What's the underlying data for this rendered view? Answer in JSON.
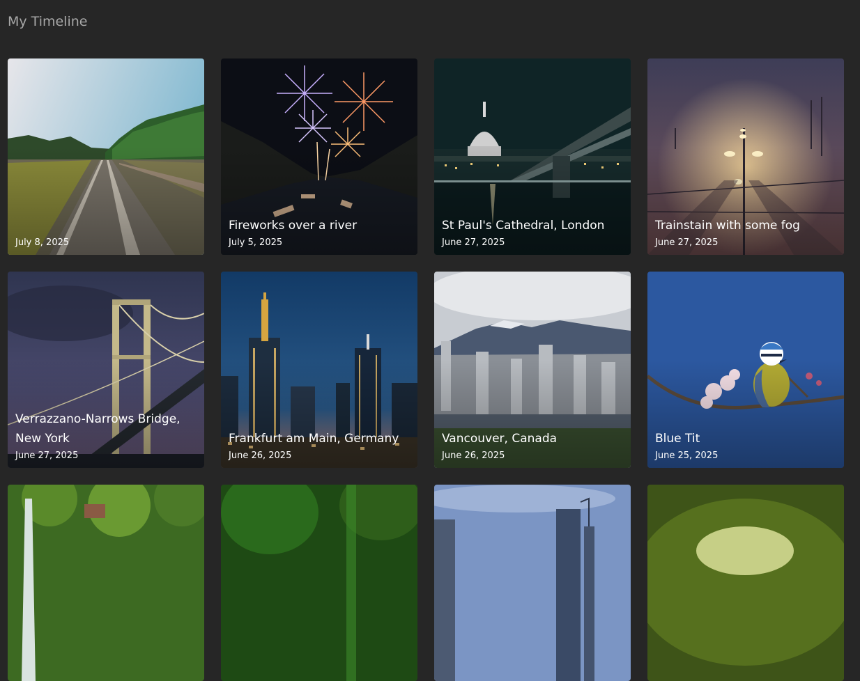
{
  "header": {
    "title": "My Timeline"
  },
  "cards": [
    {
      "title": "",
      "date": "July 8, 2025",
      "image": "railway-tracks-forest"
    },
    {
      "title": "Fireworks over a river",
      "date": "July 5, 2025",
      "image": "fireworks-river-night"
    },
    {
      "title": "St Paul's Cathedral, London",
      "date": "June 27, 2025",
      "image": "st-pauls-cathedral-bridge"
    },
    {
      "title": "Trainstain with some fog",
      "date": "June 27, 2025",
      "image": "foggy-train-station"
    },
    {
      "title": "Verrazzano-Narrows Bridge, New York",
      "date": "June 27, 2025",
      "image": "suspension-bridge-dusk"
    },
    {
      "title": "Frankfurt am Main, Germany",
      "date": "June 26, 2025",
      "image": "frankfurt-skyline-night"
    },
    {
      "title": "Vancouver, Canada",
      "date": "June 26, 2025",
      "image": "vancouver-skyline-mountains"
    },
    {
      "title": "Blue Tit",
      "date": "June 25, 2025",
      "image": "blue-tit-bird-blossom"
    },
    {
      "title": "",
      "date": "",
      "image": "waterfall-forest"
    },
    {
      "title": "",
      "date": "",
      "image": "green-leaves-closeup"
    },
    {
      "title": "",
      "date": "",
      "image": "city-skyline-cranes"
    },
    {
      "title": "",
      "date": "",
      "image": "green-fruit-closeup"
    }
  ]
}
